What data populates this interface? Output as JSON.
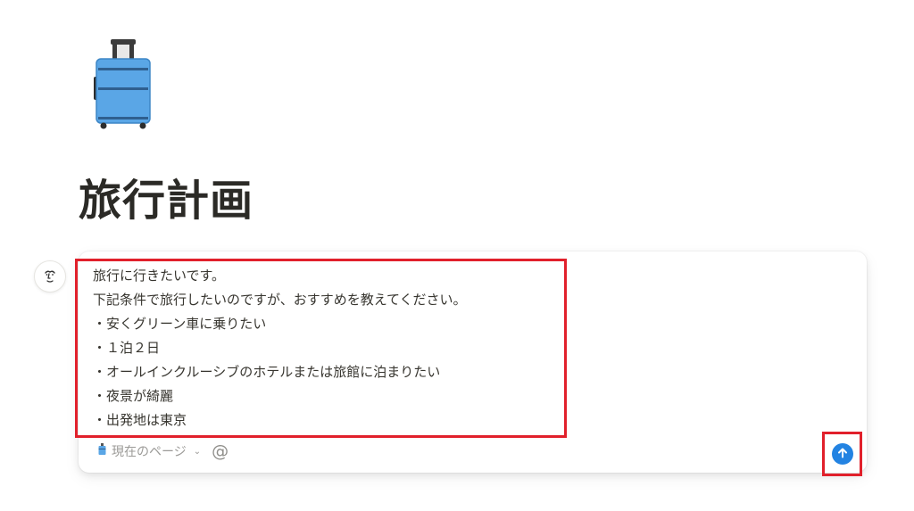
{
  "page": {
    "icon": "luggage-icon",
    "title": "旅行計画"
  },
  "chat": {
    "avatar_icon": "ai-face-icon",
    "prompt_lines": [
      "旅行に行きたいです。",
      "下記条件で旅行したいのですが、おすすめを教えてください。",
      "・安くグリーン車に乗りたい",
      "・１泊２日",
      "・オールインクルーシブのホテルまたは旅館に泊まりたい",
      "・夜景が綺麗",
      "・出発地は東京"
    ],
    "context_label": "現在のページ",
    "context_icon": "luggage-icon",
    "mention_symbol": "@",
    "send_icon": "arrow-up-icon"
  },
  "colors": {
    "accent": "#2383e2",
    "highlight": "#e1202b",
    "text": "#37352f",
    "muted": "#9b9a97"
  }
}
